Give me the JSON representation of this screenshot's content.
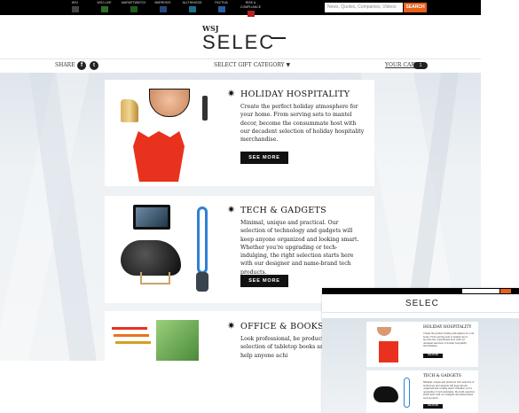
{
  "topbar": {
    "links": [
      {
        "label": "WSJ",
        "icon": "wsj-icon"
      },
      {
        "label": "WSJ.LIVE",
        "icon": "live-icon"
      },
      {
        "label": "MARKETWATCH",
        "icon": "marketwatch-icon"
      },
      {
        "label": "BARRON'S",
        "icon": "barrons-icon"
      },
      {
        "label": "ALLTHINGSD",
        "icon": "allthingsd-icon"
      },
      {
        "label": "FACTIVA",
        "icon": "factiva-icon"
      },
      {
        "label": "RISK & COMPLIANCE",
        "icon": "risk-icon"
      }
    ],
    "search_placeholder": "News, Quotes, Companies, Videos",
    "search_button": "SEARCH"
  },
  "header": {
    "brand_small": "WSJ",
    "brand_large": "SELEC"
  },
  "nav": {
    "share_label": "SHARE",
    "category_label": "SELECT GIFT CATEGORY ▼",
    "cart_label": "YOUR CART",
    "cart_count": "1"
  },
  "cards": [
    {
      "title": "HOLIDAY HOSPITALITY",
      "description": "Create the perfect holiday atmosphere for your home. From serving sets to mantel decor, become the consummate host with our decadent selection of holiday hospitality merchandise.",
      "button": "SEE MORE"
    },
    {
      "title": "TECH & GADGETS",
      "description": "Minimal, unique and practical. Our selection of technology and gadgets will keep anyone organized and looking smart. Whether you're upgrading or tech-indulging, the right selection starts here with our designer and name-brand tech products.",
      "button": "SEE MORE"
    },
    {
      "title": "OFFICE & BOOKS",
      "description": "Look professional, be productive. This selection of tabletop books and accessories will help anyone achi"
    }
  ],
  "colors": {
    "topbar_bg": "#000000",
    "search_button": "#e5611c",
    "button_bg": "#111111",
    "accent_red": "#e8321e",
    "dyson_blue": "#2f7fd6"
  }
}
